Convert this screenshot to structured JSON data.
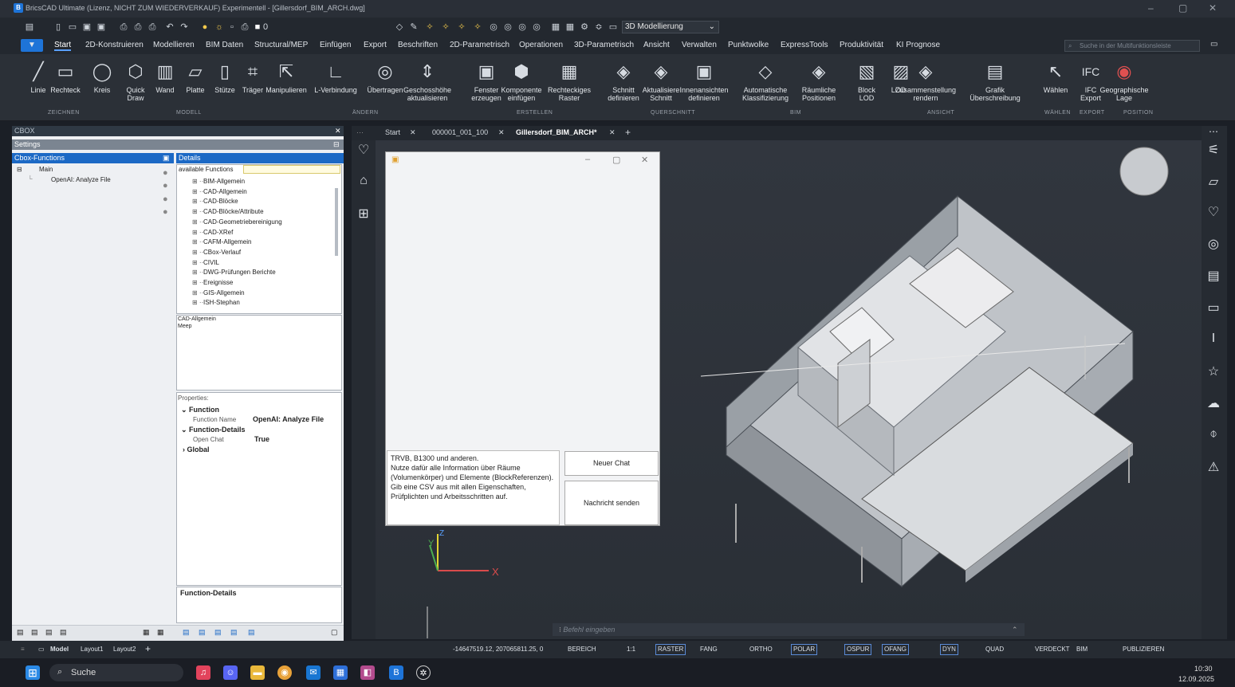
{
  "window": {
    "title": "BricsCAD Ultimate (Lizenz, NICHT ZUM WIEDERVERKAUF) Experimentell - [Gillersdorf_BIM_ARCH.dwg]",
    "app_icon_letter": "B"
  },
  "qat": {
    "layer_value": "0",
    "workspace": "3D Modellierung"
  },
  "ribbon_tabs": [
    "Start",
    "2D-Konstruieren",
    "Modellieren",
    "BIM Daten",
    "Structural/MEP",
    "Einfügen",
    "Export",
    "Beschriften",
    "2D-Parametrisch",
    "Operationen",
    "3D-Parametrisch",
    "Ansicht",
    "Verwalten",
    "Punktwolke",
    "ExpressTools",
    "Produktivität",
    "KI Prognose"
  ],
  "ribbon_search_placeholder": "Suche in der Multifunktionsleiste",
  "ribbon_buttons": [
    {
      "label": "Linie",
      "icon": "line-icon"
    },
    {
      "label": "Rechteck",
      "icon": "rectangle-icon"
    },
    {
      "label": "Kreis",
      "icon": "circle-icon"
    },
    {
      "label": "Quick\nDraw",
      "icon": "quick-draw-icon"
    },
    {
      "label": "Wand",
      "icon": "wall-icon"
    },
    {
      "label": "Platte",
      "icon": "slab-icon"
    },
    {
      "label": "Stütze",
      "icon": "column-icon"
    },
    {
      "label": "Träger",
      "icon": "beam-icon"
    },
    {
      "label": "Manipulieren",
      "icon": "manipulate-icon"
    },
    {
      "label": "L-Verbindung",
      "icon": "l-connection-icon"
    },
    {
      "label": "Übertragen",
      "icon": "transfer-icon"
    },
    {
      "label": "Geschosshöhe\naktualisieren",
      "icon": "story-height-icon"
    },
    {
      "label": "Fenster\nerzeugen",
      "icon": "window-icon"
    },
    {
      "label": "Komponente\neinfügen",
      "icon": "component-icon"
    },
    {
      "label": "Rechteckiges\nRaster",
      "icon": "grid-icon"
    },
    {
      "label": "Schnitt\ndefinieren",
      "icon": "section-icon"
    },
    {
      "label": "Aktualisiere\nSchnitt",
      "icon": "update-section-icon"
    },
    {
      "label": "Innenansichten\ndefinieren",
      "icon": "interior-view-icon"
    },
    {
      "label": "Automatische\nKlassifizierung",
      "icon": "classify-icon"
    },
    {
      "label": "Räumliche\nPositionen",
      "icon": "spatial-icon"
    },
    {
      "label": "Block\nLOD",
      "icon": "block-lod-icon"
    },
    {
      "label": "LOD",
      "icon": "lod-icon"
    },
    {
      "label": "Zusammenstellung\nrendern",
      "icon": "render-icon"
    },
    {
      "label": "Grafik\nÜberschreibung",
      "icon": "graphic-override-icon"
    },
    {
      "label": "Wählen",
      "icon": "select-icon"
    },
    {
      "label": "IFC\nExport",
      "icon": "ifc-icon"
    },
    {
      "label": "Geographische\nLage",
      "icon": "geo-icon"
    }
  ],
  "ribbon_groups": [
    "ZEICHNEN",
    "MODELL",
    "ÄNDERN",
    "ERSTELLEN",
    "QUERSCHNITT",
    "BIM",
    "ANSICHT",
    "WÄHLEN",
    "EXPORT",
    "POSITION"
  ],
  "cbox": {
    "header": "CBOX",
    "settings": "Settings",
    "functions_header": "Cbox-Functions",
    "tree_root": "Main",
    "tree_child": "OpenAI: Analyze File",
    "details_header": "Details",
    "search_label": "available Functions",
    "functions": [
      "BIM-Allgemein",
      "CAD-Allgemein",
      "CAD-Blöcke",
      "CAD-Blöcke/Attribute",
      "CAD-Geometriebereinigung",
      "CAD-XRef",
      "CAFM-Allgemein",
      "CBox-Verlauf",
      "CIVIL",
      "DWG-Prüfungen Berichte",
      "Ereignisse",
      "GIS-Allgemein",
      "ISH-Stephan"
    ],
    "desc_line1": "CAD-Allgemein",
    "desc_line2": "Meep",
    "properties_header": "Properties:",
    "prop_function": "Function",
    "prop_function_name_label": "Function Name",
    "prop_function_name_value": "OpenAI: Analyze File",
    "prop_function_details": "Function-Details",
    "prop_open_chat_label": "Open Chat",
    "prop_open_chat_value": "True",
    "prop_global": "Global",
    "footer_title": "Function-Details"
  },
  "viewport_tabs": [
    "Start",
    "000001_001_100",
    "Gillersdorf_BIM_ARCH*"
  ],
  "chat": {
    "message": "TRVB, B1300 und anderen.\nNutze dafür alle Information über Räume (Volumenkörper) und Elemente (BlockReferenzen). Gib eine CSV aus mit allen Eigenschaften, Prüfplichten und Arbeitsschritten auf.",
    "new_chat": "Neuer Chat",
    "send": "Nachricht senden"
  },
  "command_placeholder": "Befehl eingeben",
  "axis": {
    "x": "X",
    "y": "Y",
    "z": "Z"
  },
  "status": {
    "layouts": [
      "Model",
      "Layout1",
      "Layout2"
    ],
    "coords": "-14647519.12, 207065811.25, 0",
    "items": [
      "BEREICH",
      "1:1",
      "RASTER",
      "FANG",
      "ORTHO",
      "POLAR",
      "OSPUR",
      "OFANG",
      "DYN",
      "QUAD",
      "VERDECKT",
      "BIM",
      "PUBLIZIEREN"
    ]
  },
  "taskbar": {
    "search": "Suche",
    "time": "10:30",
    "date": "12.09.2025"
  }
}
